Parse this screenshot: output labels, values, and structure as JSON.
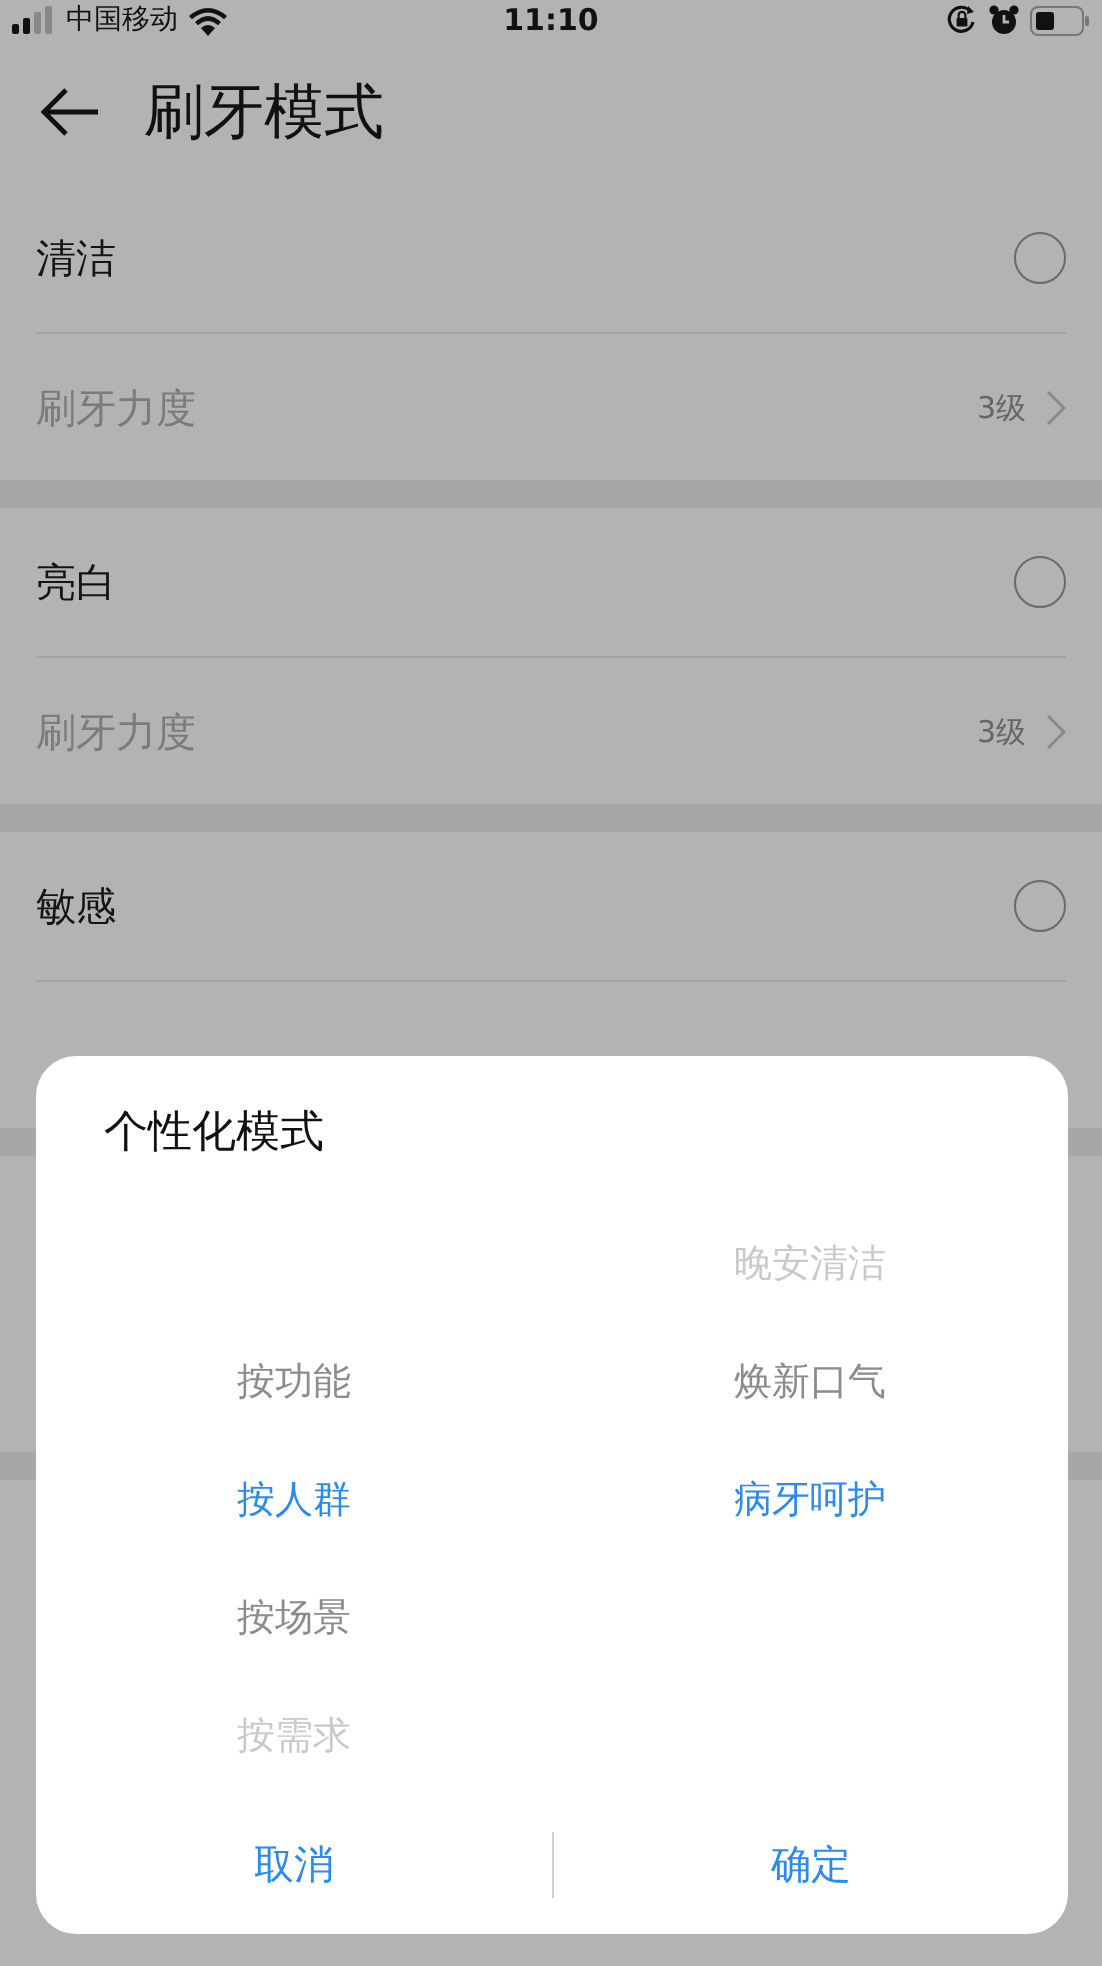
{
  "status_bar": {
    "carrier": "中国移动",
    "time": "11:10"
  },
  "header": {
    "title": "刷牙模式"
  },
  "sections": [
    {
      "title": "清洁",
      "selected": false,
      "setting": {
        "label": "刷牙力度",
        "value": "3级"
      }
    },
    {
      "title": "亮白",
      "selected": false,
      "setting": {
        "label": "刷牙力度",
        "value": "3级"
      }
    },
    {
      "title": "敏感",
      "selected": false
    }
  ],
  "dialog": {
    "title": "个性化模式",
    "columns": [
      {
        "items": [
          {
            "label": "按功能",
            "selected": false
          },
          {
            "label": "按人群",
            "selected": true
          },
          {
            "label": "按场景",
            "selected": false
          },
          {
            "label": "按需求",
            "selected": false
          }
        ]
      },
      {
        "items": [
          {
            "label": "晚安清洁",
            "selected": false
          },
          {
            "label": "焕新口气",
            "selected": false
          },
          {
            "label": "病牙呵护",
            "selected": true
          }
        ]
      }
    ],
    "buttons": [
      "取消",
      "确定"
    ]
  }
}
